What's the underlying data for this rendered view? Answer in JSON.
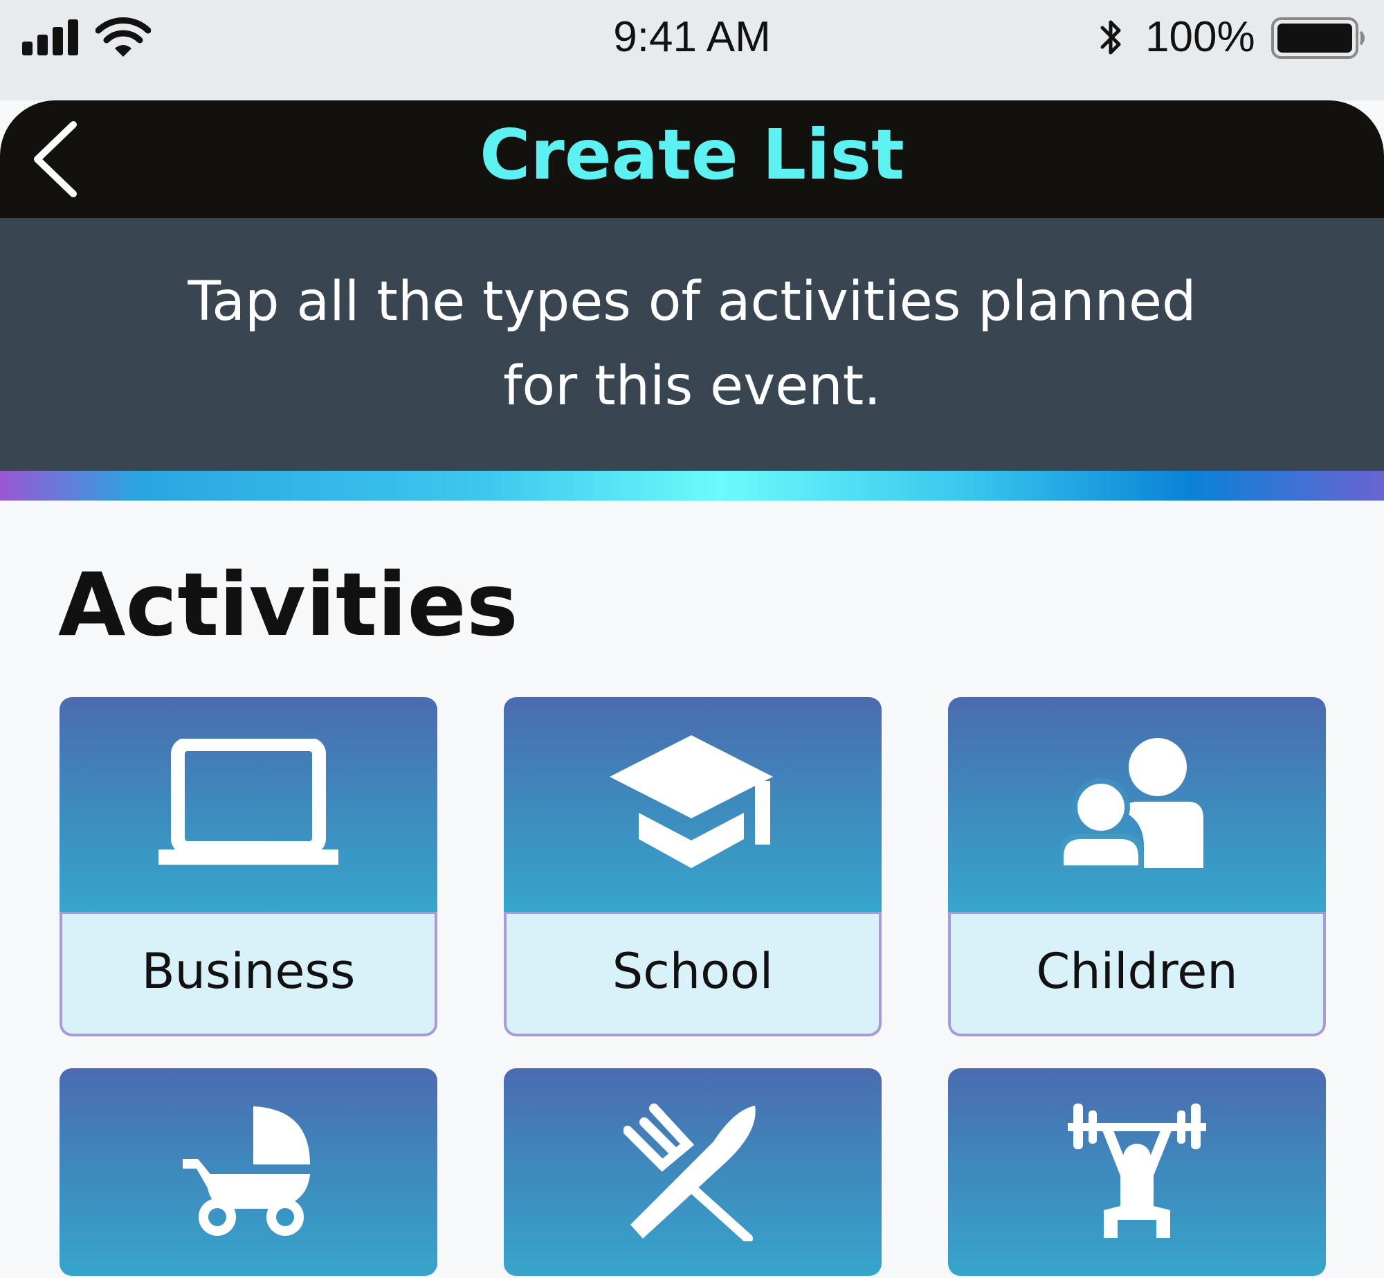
{
  "status_bar": {
    "time": "9:41 AM",
    "battery_percent": "100%",
    "signal_icon": "cellular-signal-icon",
    "wifi_icon": "wifi-icon",
    "bluetooth_icon": "bluetooth-icon",
    "battery_icon": "battery-icon"
  },
  "nav": {
    "title": "Create List",
    "back_icon": "back-chevron-icon"
  },
  "instruction": {
    "line1": "Tap all the types of activities planned",
    "line2": "for this event."
  },
  "section": {
    "title": "Activities"
  },
  "activities": [
    {
      "label": "Business",
      "icon": "laptop-icon"
    },
    {
      "label": "School",
      "icon": "graduation-cap-icon"
    },
    {
      "label": "Children",
      "icon": "parent-child-icon"
    },
    {
      "label": "",
      "icon": "stroller-icon"
    },
    {
      "label": "",
      "icon": "fork-knife-icon"
    },
    {
      "label": "",
      "icon": "weightlifter-icon"
    }
  ],
  "colors": {
    "nav_background": "#13110d",
    "title_accent": "#5ef1f1",
    "instruction_background": "#394651",
    "tile_gradient_top": "#4b6bb0",
    "tile_gradient_bottom": "#36a5cc",
    "tile_label_background": "#d9f1f8",
    "tile_border": "#a89ad8"
  }
}
